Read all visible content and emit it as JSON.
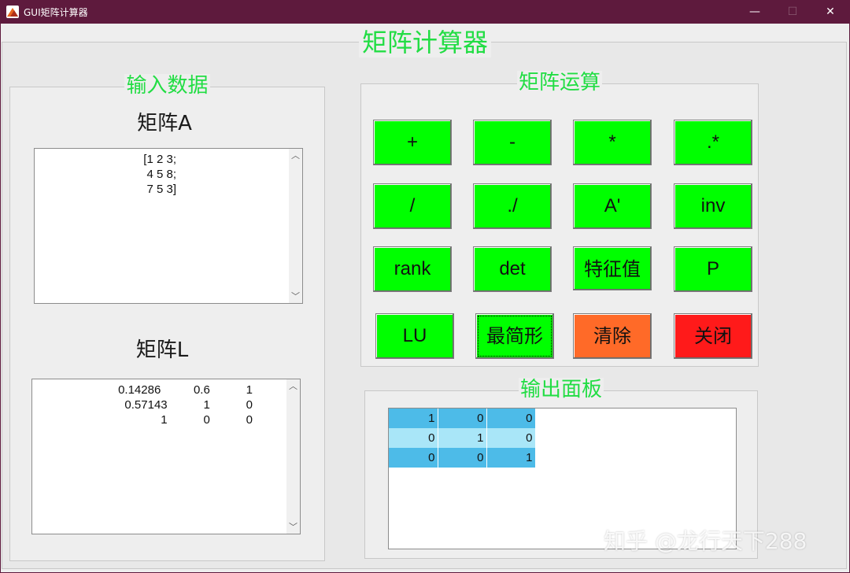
{
  "window": {
    "title": "GUI矩阵计算器",
    "minimize_glyph": "—",
    "maximize_glyph": "☐",
    "close_glyph": "✕"
  },
  "app": {
    "title": "矩阵计算器"
  },
  "input_panel": {
    "caption": "输入数据",
    "matrix_a_label": "矩阵A",
    "matrix_a_value": "[1 2 3;\n4 5 8;\n7 5 3]",
    "matrix_l_label": "矩阵L",
    "matrix_l_value": "0.14286          0.6           1\n0.57143           1           0\n1           0           0"
  },
  "ops_panel": {
    "caption": "矩阵运算",
    "buttons": [
      {
        "label": "+",
        "color": "#00ff00"
      },
      {
        "label": "-",
        "color": "#00ff00"
      },
      {
        "label": "*",
        "color": "#00ff00"
      },
      {
        "label": ".*",
        "color": "#00ff00"
      },
      {
        "label": "/",
        "color": "#00ff00"
      },
      {
        "label": "./",
        "color": "#00ff00"
      },
      {
        "label": "A'",
        "color": "#00ff00"
      },
      {
        "label": "inv",
        "color": "#00ff00"
      },
      {
        "label": "rank",
        "color": "#00ff00"
      },
      {
        "label": "det",
        "color": "#00ff00"
      },
      {
        "label": "特征值",
        "color": "#00ff00"
      },
      {
        "label": "P",
        "color": "#00ff00"
      },
      {
        "label": "LU",
        "color": "#00ff00"
      },
      {
        "label": "最简形",
        "color": "#00ff00"
      },
      {
        "label": "清除",
        "color": "#ff6a28"
      },
      {
        "label": "关闭",
        "color": "#ff1a1a"
      }
    ]
  },
  "output_panel": {
    "caption": "输出面板",
    "rows": [
      [
        "1",
        "0",
        "0"
      ],
      [
        "0",
        "1",
        "0"
      ],
      [
        "0",
        "0",
        "1"
      ]
    ]
  },
  "watermark": "知乎 @龙行天下288",
  "colors": {
    "titlebar": "#5e1a3d",
    "caption_green": "#22dd44",
    "button_green": "#00ff00",
    "clear_orange": "#ff6a28",
    "close_red": "#ff1a1a",
    "table_dark": "#4dbbe8",
    "table_light": "#a9e6f8"
  }
}
